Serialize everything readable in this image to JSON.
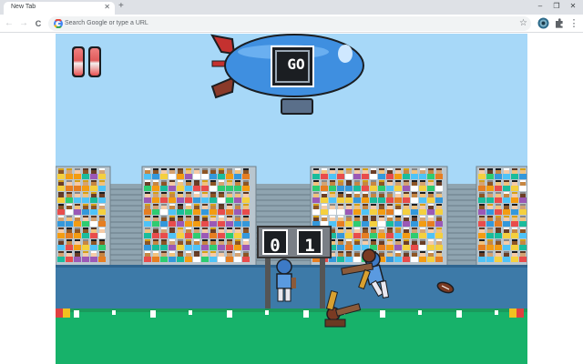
{
  "browser": {
    "tab_title": "New Tab",
    "tab_close": "✕",
    "new_tab": "+",
    "window_controls": [
      "–",
      "❐",
      "✕"
    ],
    "back": "←",
    "forward": "→",
    "reload": "C",
    "omnibox_placeholder": "Search Google or type a URL",
    "bookmark_star": "☆",
    "menu_dots": "⋮",
    "icons": [
      "g-logo-icon",
      "profile-icon",
      "extensions-icon",
      "menu-icon"
    ]
  },
  "game": {
    "blimp_sign": "GO",
    "score_left": "0",
    "score_right": "1",
    "colors": {
      "sky": "#a7d8f8",
      "blimp": "#3f8fe0",
      "field": "#17b26a",
      "wall": "#3d7aa8",
      "stands": "#8fa4b0"
    }
  }
}
